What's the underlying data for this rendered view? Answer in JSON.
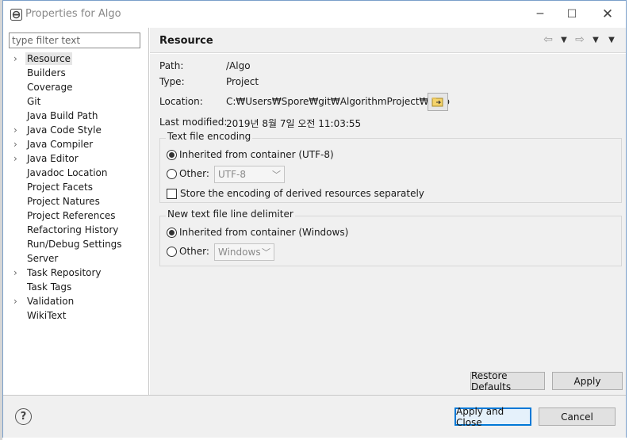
{
  "window": {
    "title": "Properties for Algo",
    "minimize_glyph": "─",
    "maximize_glyph": "☐",
    "close_glyph": "✕"
  },
  "filter": {
    "placeholder": "type filter text",
    "value": ""
  },
  "tree": [
    {
      "label": "Resource",
      "expandable": true,
      "selected": true
    },
    {
      "label": "Builders",
      "expandable": false
    },
    {
      "label": "Coverage",
      "expandable": false
    },
    {
      "label": "Git",
      "expandable": false
    },
    {
      "label": "Java Build Path",
      "expandable": false
    },
    {
      "label": "Java Code Style",
      "expandable": true
    },
    {
      "label": "Java Compiler",
      "expandable": true
    },
    {
      "label": "Java Editor",
      "expandable": true
    },
    {
      "label": "Javadoc Location",
      "expandable": false
    },
    {
      "label": "Project Facets",
      "expandable": false
    },
    {
      "label": "Project Natures",
      "expandable": false
    },
    {
      "label": "Project References",
      "expandable": false
    },
    {
      "label": "Refactoring History",
      "expandable": false
    },
    {
      "label": "Run/Debug Settings",
      "expandable": false
    },
    {
      "label": "Server",
      "expandable": false
    },
    {
      "label": "Task Repository",
      "expandable": true
    },
    {
      "label": "Task Tags",
      "expandable": false
    },
    {
      "label": "Validation",
      "expandable": true
    },
    {
      "label": "WikiText",
      "expandable": false
    }
  ],
  "page": {
    "title": "Resource",
    "nav": {
      "back": "⇦",
      "forward": "⇨",
      "dropdown": "▼"
    },
    "path_label": "Path:",
    "path_value": "/Algo",
    "type_label": "Type:",
    "type_value": "Project",
    "location_label": "Location:",
    "location_value": "C:₩Users₩Spore₩git₩AlgorithmProject₩Algo",
    "modified_label": "Last modified:",
    "modified_value": "2019년 8월 7일 오전 11:03:55",
    "encoding": {
      "title": "Text file encoding",
      "inherited_label": "Inherited from container (UTF-8)",
      "inherited_selected": true,
      "other_label": "Other:",
      "other_value": "UTF-8",
      "store_label": "Store the encoding of derived resources separately",
      "store_checked": false
    },
    "delimiter": {
      "title": "New text file line delimiter",
      "inherited_label": "Inherited from container (Windows)",
      "inherited_selected": true,
      "other_label": "Other:",
      "other_value": "Windows"
    },
    "restore_defaults_label": "Restore Defaults",
    "apply_label": "Apply"
  },
  "footer": {
    "help_glyph": "?",
    "apply_close_label": "Apply and Close",
    "cancel_label": "Cancel"
  },
  "colors": {
    "accent": "#0078d7",
    "panel_bg": "#f0f0f0",
    "selection_bg": "#e5e5e5"
  }
}
